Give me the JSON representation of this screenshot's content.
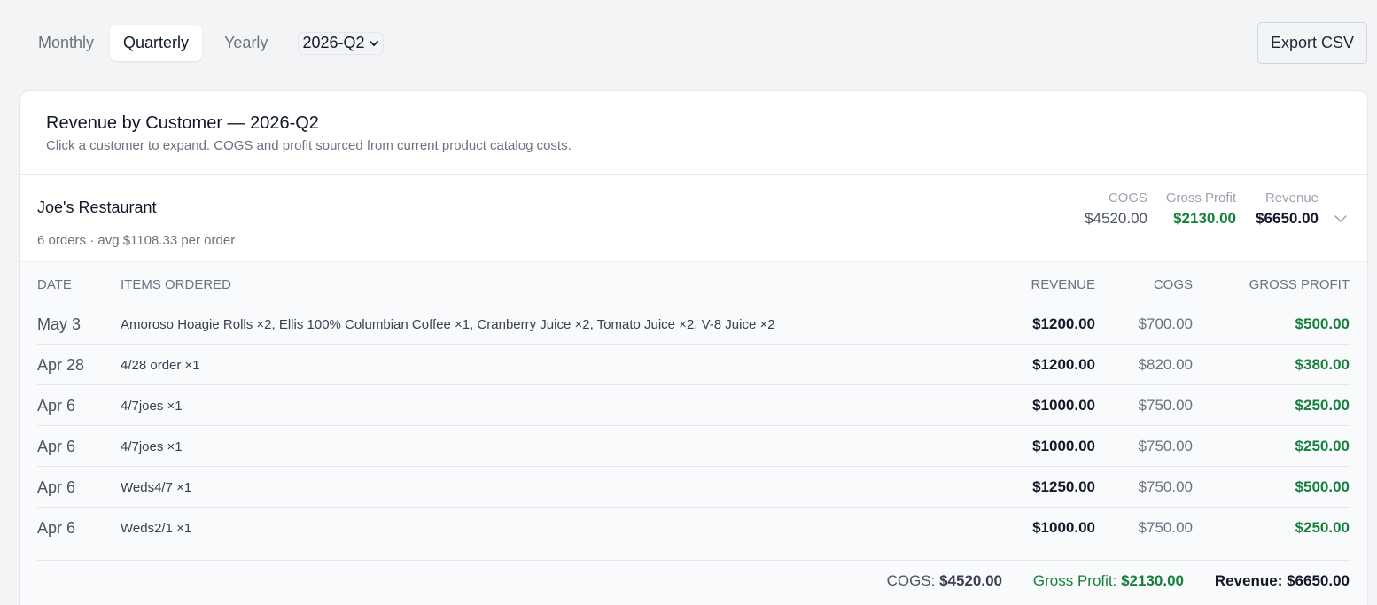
{
  "tabs": [
    {
      "label": "Monthly",
      "active": false
    },
    {
      "label": "Quarterly",
      "active": true
    },
    {
      "label": "Yearly",
      "active": false
    }
  ],
  "period_select": {
    "value": "2026-Q2",
    "icon": "chevron-down-icon"
  },
  "export_label": "Export CSV",
  "card": {
    "title": "Revenue by Customer — 2026-Q2",
    "subtitle": "Click a customer to expand. COGS and profit sourced from current product catalog costs."
  },
  "customer": {
    "name": "Joe's Restaurant",
    "meta": "6 orders · avg $1108.33 per order",
    "cogs_label": "COGS",
    "cogs": "$4520.00",
    "gp_label": "Gross Profit",
    "gp": "$2130.00",
    "rev_label": "Revenue",
    "rev": "$6650.00",
    "expand_icon": "chevron-down-icon"
  },
  "orders": {
    "headers": {
      "date": "DATE",
      "items": "ITEMS ORDERED",
      "revenue": "REVENUE",
      "cogs": "COGS",
      "gp": "GROSS PROFIT"
    },
    "rows": [
      {
        "date": "May 3",
        "items": "Amoroso Hoagie Rolls ×2, Ellis 100% Columbian Coffee ×1, Cranberry Juice ×2, Tomato Juice ×2, V-8 Juice ×2",
        "revenue": "$1200.00",
        "cogs": "$700.00",
        "gp": "$500.00"
      },
      {
        "date": "Apr 28",
        "items": "4/28 order ×1",
        "revenue": "$1200.00",
        "cogs": "$820.00",
        "gp": "$380.00"
      },
      {
        "date": "Apr 6",
        "items": "4/7joes ×1",
        "revenue": "$1000.00",
        "cogs": "$750.00",
        "gp": "$250.00"
      },
      {
        "date": "Apr 6",
        "items": "4/7joes ×1",
        "revenue": "$1000.00",
        "cogs": "$750.00",
        "gp": "$250.00"
      },
      {
        "date": "Apr 6",
        "items": "Weds4/7 ×1",
        "revenue": "$1250.00",
        "cogs": "$750.00",
        "gp": "$500.00"
      },
      {
        "date": "Apr 6",
        "items": "Weds2/1 ×1",
        "revenue": "$1000.00",
        "cogs": "$750.00",
        "gp": "$250.00"
      }
    ],
    "totals": {
      "cogs_label": "COGS:",
      "cogs": "$4520.00",
      "gp_label": "Gross Profit:",
      "gp": "$2130.00",
      "rev_label": "Revenue:",
      "rev": "$6650.00"
    }
  },
  "colors": {
    "profit": "#15803d",
    "page_bg": "#f3f4f6",
    "card_bg": "#ffffff"
  }
}
